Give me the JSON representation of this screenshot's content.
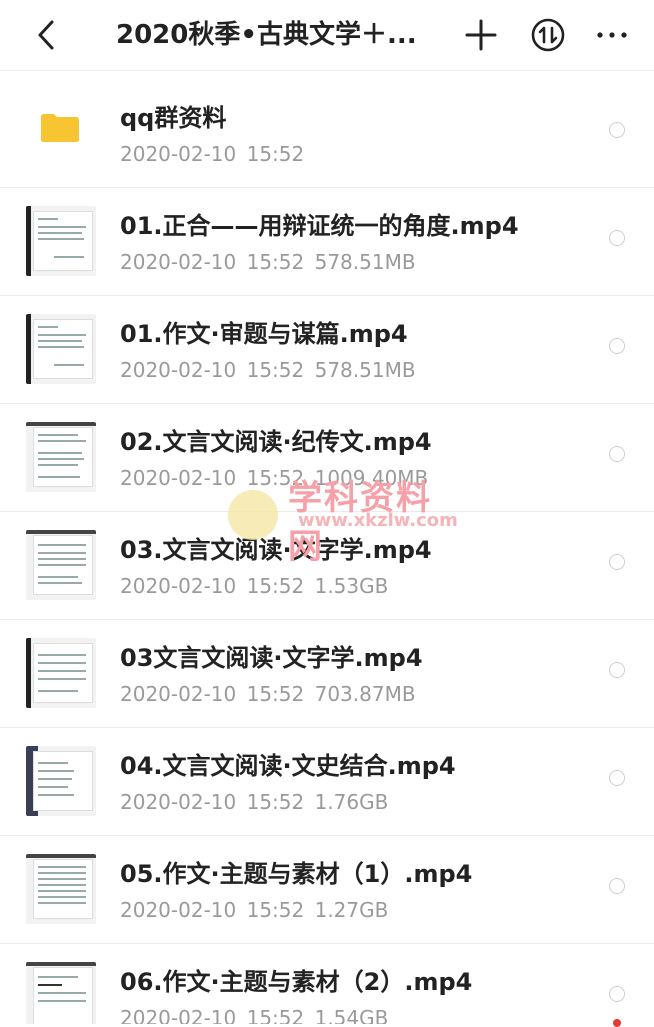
{
  "header": {
    "title": "2020秋季•古典文学＋...",
    "back_icon": "back-chevron-icon",
    "add_icon": "plus-icon",
    "sort_icon": "sort-icon",
    "more_icon": "more-horizontal-icon"
  },
  "items": [
    {
      "type": "folder",
      "name": "qq群资料",
      "date": "2020-02-10",
      "time": "15:52",
      "size": ""
    },
    {
      "type": "video",
      "name": "01.正合——用辩证统一的角度.mp4",
      "date": "2020-02-10",
      "time": "15:52",
      "size": "578.51MB"
    },
    {
      "type": "video",
      "name": "01.作文·审题与谋篇.mp4",
      "date": "2020-02-10",
      "time": "15:52",
      "size": "578.51MB"
    },
    {
      "type": "video",
      "name": "02.文言文阅读·纪传文.mp4",
      "date": "2020-02-10",
      "time": "15:52",
      "size": "1009.40MB"
    },
    {
      "type": "video",
      "name": "03.文言文阅读·文字学.mp4",
      "date": "2020-02-10",
      "time": "15:52",
      "size": "1.53GB"
    },
    {
      "type": "video",
      "name": "03文言文阅读·文字学.mp4",
      "date": "2020-02-10",
      "time": "15:52",
      "size": "703.87MB"
    },
    {
      "type": "video",
      "name": "04.文言文阅读·文史结合.mp4",
      "date": "2020-02-10",
      "time": "15:52",
      "size": "1.76GB"
    },
    {
      "type": "video",
      "name": "05.作文·主题与素材（1）.mp4",
      "date": "2020-02-10",
      "time": "15:52",
      "size": "1.27GB"
    },
    {
      "type": "video",
      "name": "06.作文·主题与素材（2）.mp4",
      "date": "2020-02-10",
      "time": "15:52",
      "size": "1.54GB"
    }
  ],
  "watermark": {
    "title": "学科资料网",
    "url": "www.xkzlw.com"
  },
  "colors": {
    "folder": "#f7c531",
    "meta": "#9a9a9a",
    "watermark": "#f6a0a8"
  }
}
